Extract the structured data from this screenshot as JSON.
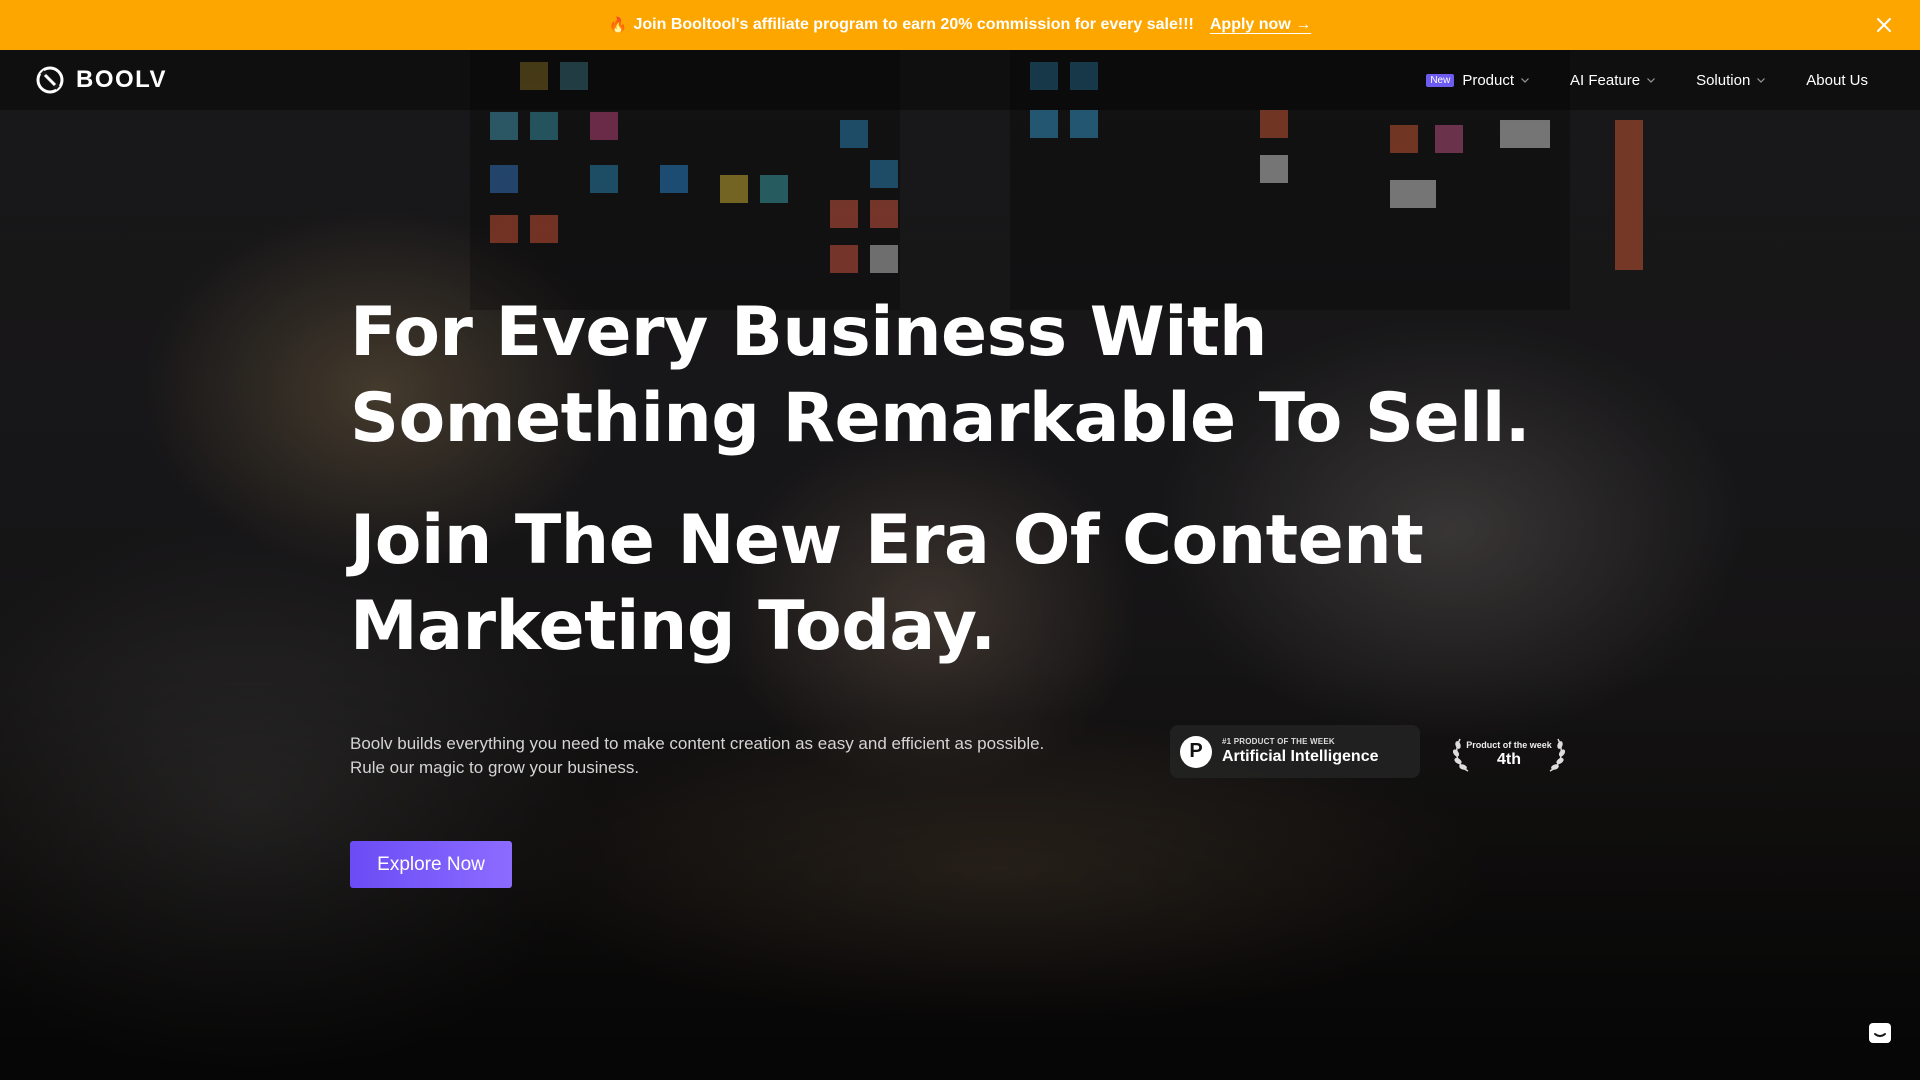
{
  "banner": {
    "text": "Join Booltool's affiliate program to earn 20% commission for every sale!!!",
    "link": "Apply now →",
    "emoji": "🔥"
  },
  "nav": {
    "logo": "BOOLV",
    "new_badge": "New",
    "items": [
      "Product",
      "AI Feature",
      "Solution",
      "About Us"
    ]
  },
  "hero": {
    "headline_1": "For Every Business With Something Remarkable To Sell.",
    "headline_2": "Join The New Era Of Content Marketing Today.",
    "desc_line_1": "Boolv builds everything you need to make content creation as easy and efficient as possible.",
    "desc_line_2": "Rule our magic to grow your business.",
    "cta": "Explore Now"
  },
  "badges": {
    "ph_small": "#1 PRODUCT OF THE WEEK",
    "ph_big": "Artificial Intelligence",
    "ph_letter": "P",
    "potw_small": "Product of the week",
    "potw_big": "4th"
  },
  "colors": {
    "banner": "#fea600",
    "accent": "#6b4cf5"
  }
}
